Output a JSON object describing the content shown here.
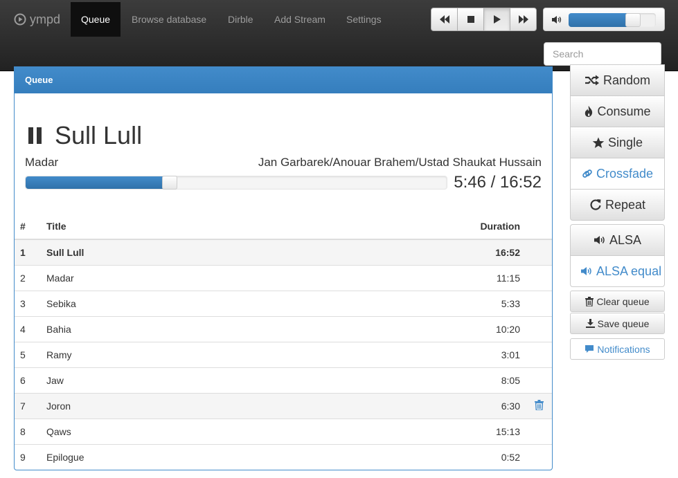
{
  "brand": {
    "name": "ympd"
  },
  "nav": {
    "items": [
      {
        "label": "Queue",
        "active": true
      },
      {
        "label": "Browse database",
        "active": false
      },
      {
        "label": "Dirble",
        "active": false
      },
      {
        "label": "Add Stream",
        "active": false
      },
      {
        "label": "Settings",
        "active": false
      }
    ]
  },
  "controls": {
    "buttons": [
      "prev-icon",
      "stop-icon",
      "play-icon",
      "next-icon"
    ],
    "active": "play-icon",
    "volume_percent": 74,
    "volume_icon": "volume-icon"
  },
  "search": {
    "placeholder": "Search",
    "value": ""
  },
  "panel": {
    "heading": "Queue",
    "now_playing": {
      "state_icon": "pause-icon",
      "title": "Sull Lull",
      "album": "Madar",
      "artist": "Jan Garbarek/Anouar Brahem/Ustad Shaukat Hussain",
      "elapsed": "5:46",
      "total": "16:52",
      "progress_fraction": 0.342,
      "time_text": "5:46 / 16:52"
    },
    "table": {
      "headers": {
        "num": "#",
        "title": "Title",
        "duration": "Duration"
      },
      "rows": [
        {
          "num": "1",
          "title": "Sull Lull",
          "duration": "16:52"
        },
        {
          "num": "2",
          "title": "Madar",
          "duration": "11:15"
        },
        {
          "num": "3",
          "title": "Sebika",
          "duration": "5:33"
        },
        {
          "num": "4",
          "title": "Bahia",
          "duration": "10:20"
        },
        {
          "num": "5",
          "title": "Ramy",
          "duration": "3:01"
        },
        {
          "num": "6",
          "title": "Jaw",
          "duration": "8:05"
        },
        {
          "num": "7",
          "title": "Joron",
          "duration": "6:30"
        },
        {
          "num": "8",
          "title": "Qaws",
          "duration": "15:13"
        },
        {
          "num": "9",
          "title": "Epilogue",
          "duration": "0:52"
        }
      ],
      "active_row": 0,
      "hover_row": 6,
      "row_action_icon": "trash-icon"
    }
  },
  "sidebar": {
    "modes": [
      {
        "label": "Random",
        "icon": "shuffle-icon",
        "on": false
      },
      {
        "label": "Consume",
        "icon": "fire-icon",
        "on": false
      },
      {
        "label": "Single",
        "icon": "star-icon",
        "on": false
      },
      {
        "label": "Crossfade",
        "icon": "link-icon",
        "on": true
      },
      {
        "label": "Repeat",
        "icon": "repeat-icon",
        "on": false
      }
    ],
    "outputs": [
      {
        "label": "ALSA",
        "icon": "volume-icon",
        "on": false
      },
      {
        "label": "ALSA equal",
        "icon": "volume-icon",
        "on": true
      }
    ],
    "clear_queue": "Clear queue",
    "save_queue": "Save queue",
    "notifications": "Notifications"
  },
  "colors": {
    "primary": "#428bca",
    "navbar": "#222222",
    "nav_text": "#9d9d9d"
  }
}
